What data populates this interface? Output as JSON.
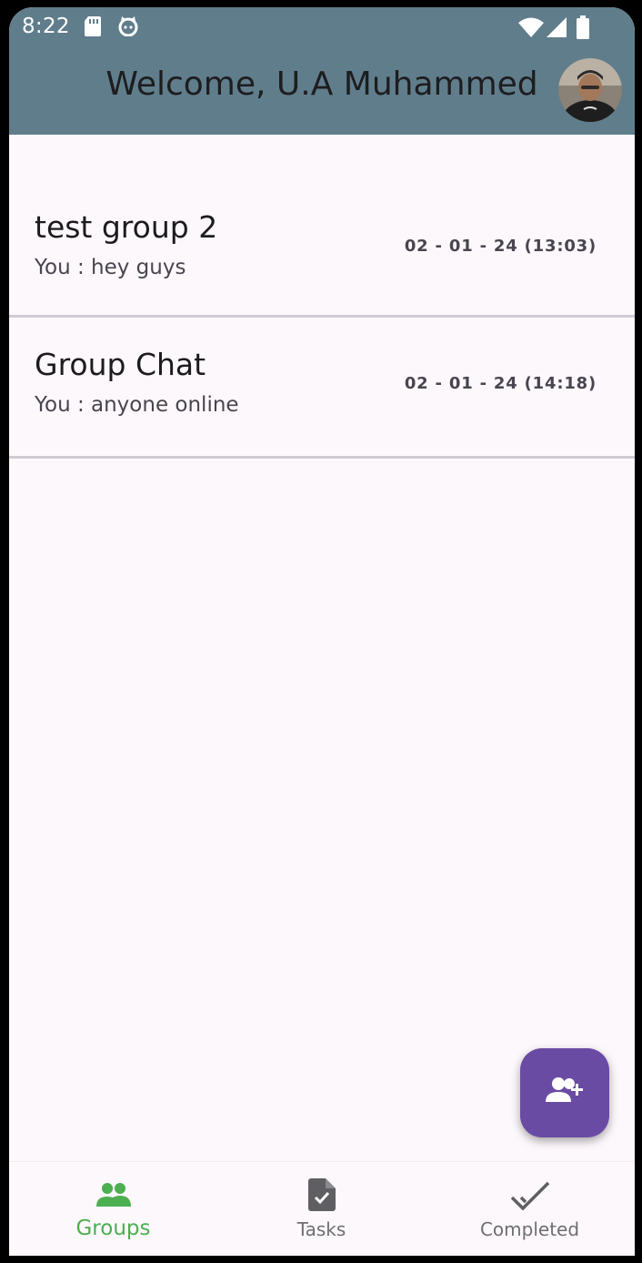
{
  "status_bar": {
    "time": "8:22",
    "icons": [
      "sd-card-icon",
      "cat-icon",
      "wifi-icon",
      "signal-icon",
      "battery-icon"
    ]
  },
  "header": {
    "title": "Welcome, U.A Muhammed",
    "background": "#607d8b"
  },
  "groups": [
    {
      "name": "test group 2",
      "last_message": "You : hey guys",
      "timestamp": "02 - 01 - 24 (13:03)"
    },
    {
      "name": "Group Chat",
      "last_message": "You : anyone online",
      "timestamp": "02 - 01 - 24 (14:18)"
    }
  ],
  "fab": {
    "icon": "add-person-icon",
    "color": "#6a4ba3"
  },
  "bottom_nav": {
    "items": [
      {
        "label": "Groups",
        "icon": "groups-icon",
        "active": true
      },
      {
        "label": "Tasks",
        "icon": "task-file-icon",
        "active": false
      },
      {
        "label": "Completed",
        "icon": "double-check-icon",
        "active": false
      }
    ],
    "active_color": "#4caf50"
  }
}
